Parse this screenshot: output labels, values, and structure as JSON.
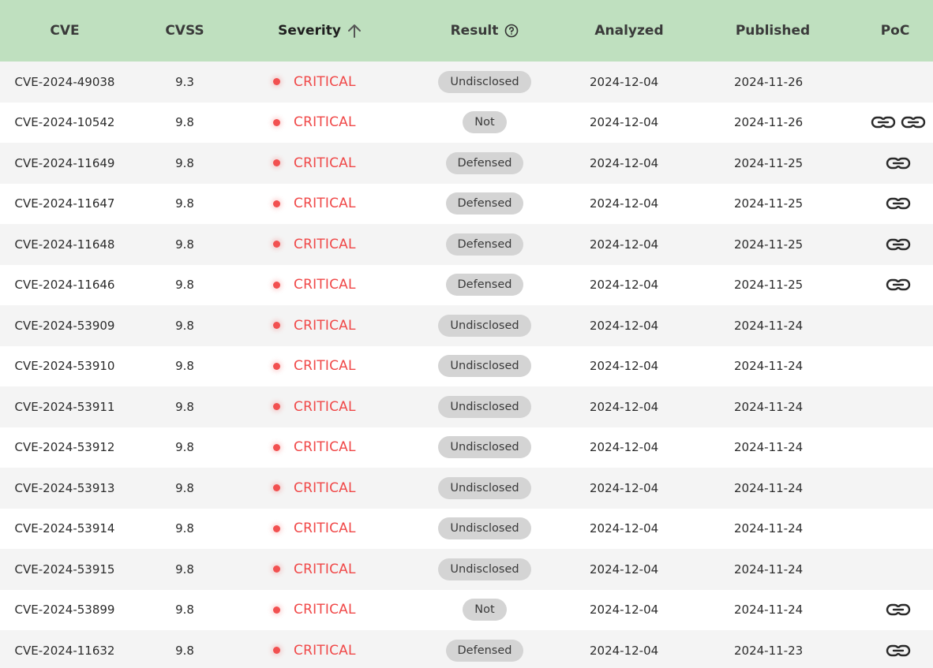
{
  "columns": {
    "cve": "CVE",
    "cvss": "CVSS",
    "severity": "Severity",
    "result": "Result",
    "analyzed": "Analyzed",
    "published": "Published",
    "poc": "PoC"
  },
  "icons": {
    "sort": "arrow-up-icon",
    "help": "question-circle-icon",
    "poc_link": "link-icon",
    "severity_dot": "red-dot"
  },
  "colors": {
    "header_bg": "#bfe0bf",
    "critical": "#f04848",
    "badge_bg": "#d4d4d4"
  },
  "rows": [
    {
      "cve": "CVE-2024-49038",
      "cvss": "9.3",
      "severity": "CRITICAL",
      "result": "Undisclosed",
      "analyzed": "2024-12-04",
      "published": "2024-11-26",
      "poc_links": 0
    },
    {
      "cve": "CVE-2024-10542",
      "cvss": "9.8",
      "severity": "CRITICAL",
      "result": "Not",
      "analyzed": "2024-12-04",
      "published": "2024-11-26",
      "poc_links": 2
    },
    {
      "cve": "CVE-2024-11649",
      "cvss": "9.8",
      "severity": "CRITICAL",
      "result": "Defensed",
      "analyzed": "2024-12-04",
      "published": "2024-11-25",
      "poc_links": 1
    },
    {
      "cve": "CVE-2024-11647",
      "cvss": "9.8",
      "severity": "CRITICAL",
      "result": "Defensed",
      "analyzed": "2024-12-04",
      "published": "2024-11-25",
      "poc_links": 1
    },
    {
      "cve": "CVE-2024-11648",
      "cvss": "9.8",
      "severity": "CRITICAL",
      "result": "Defensed",
      "analyzed": "2024-12-04",
      "published": "2024-11-25",
      "poc_links": 1
    },
    {
      "cve": "CVE-2024-11646",
      "cvss": "9.8",
      "severity": "CRITICAL",
      "result": "Defensed",
      "analyzed": "2024-12-04",
      "published": "2024-11-25",
      "poc_links": 1
    },
    {
      "cve": "CVE-2024-53909",
      "cvss": "9.8",
      "severity": "CRITICAL",
      "result": "Undisclosed",
      "analyzed": "2024-12-04",
      "published": "2024-11-24",
      "poc_links": 0
    },
    {
      "cve": "CVE-2024-53910",
      "cvss": "9.8",
      "severity": "CRITICAL",
      "result": "Undisclosed",
      "analyzed": "2024-12-04",
      "published": "2024-11-24",
      "poc_links": 0
    },
    {
      "cve": "CVE-2024-53911",
      "cvss": "9.8",
      "severity": "CRITICAL",
      "result": "Undisclosed",
      "analyzed": "2024-12-04",
      "published": "2024-11-24",
      "poc_links": 0
    },
    {
      "cve": "CVE-2024-53912",
      "cvss": "9.8",
      "severity": "CRITICAL",
      "result": "Undisclosed",
      "analyzed": "2024-12-04",
      "published": "2024-11-24",
      "poc_links": 0
    },
    {
      "cve": "CVE-2024-53913",
      "cvss": "9.8",
      "severity": "CRITICAL",
      "result": "Undisclosed",
      "analyzed": "2024-12-04",
      "published": "2024-11-24",
      "poc_links": 0
    },
    {
      "cve": "CVE-2024-53914",
      "cvss": "9.8",
      "severity": "CRITICAL",
      "result": "Undisclosed",
      "analyzed": "2024-12-04",
      "published": "2024-11-24",
      "poc_links": 0
    },
    {
      "cve": "CVE-2024-53915",
      "cvss": "9.8",
      "severity": "CRITICAL",
      "result": "Undisclosed",
      "analyzed": "2024-12-04",
      "published": "2024-11-24",
      "poc_links": 0
    },
    {
      "cve": "CVE-2024-53899",
      "cvss": "9.8",
      "severity": "CRITICAL",
      "result": "Not",
      "analyzed": "2024-12-04",
      "published": "2024-11-24",
      "poc_links": 1
    },
    {
      "cve": "CVE-2024-11632",
      "cvss": "9.8",
      "severity": "CRITICAL",
      "result": "Defensed",
      "analyzed": "2024-12-04",
      "published": "2024-11-23",
      "poc_links": 1
    }
  ]
}
